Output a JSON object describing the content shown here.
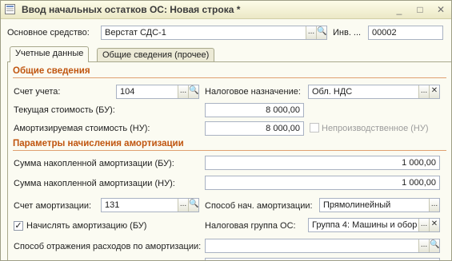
{
  "window": {
    "title": "Ввод начальных остатков ОС: Новая строка *"
  },
  "header": {
    "asset_label": "Основное средство:",
    "asset_value": "Верстат СДС-1",
    "inv_label": "Инв. ...",
    "inv_value": "00002"
  },
  "tabs": [
    {
      "label": "Учетные данные",
      "active": true
    },
    {
      "label": "Общие сведения (прочее)",
      "active": false
    }
  ],
  "general": {
    "section_title": "Общие сведения",
    "account_label": "Счет учета:",
    "account_value": "104",
    "tax_purpose_label": "Налоговое назначение:",
    "tax_purpose_value": "Обл. НДС",
    "current_cost_label": "Текущая стоимость (БУ):",
    "current_cost_value": "8 000,00",
    "depreciable_cost_label": "Амортизируемая стоимость (НУ):",
    "depreciable_cost_value": "8 000,00",
    "nonproductive_label": "Непроизводственное (НУ)"
  },
  "depreciation": {
    "section_title": "Параметры начисления амортизации",
    "accum_bu_label": "Сумма накопленной амортизации (БУ):",
    "accum_bu_value": "1 000,00",
    "accum_nu_label": "Сумма накопленной амортизации (НУ):",
    "accum_nu_value": "1 000,00",
    "dep_account_label": "Счет амортизации:",
    "dep_account_value": "131",
    "method_label": "Способ нач. амортизации:",
    "method_value": "Прямолинейный",
    "accrue_label": "Начислять амортизацию (БУ)",
    "tax_group_label": "Налоговая группа ОС:",
    "tax_group_value": "Группа 4: Машины и обор",
    "expense_method_label": "Способ отражения расходов по амортизации:",
    "expense_method_value": ""
  }
}
